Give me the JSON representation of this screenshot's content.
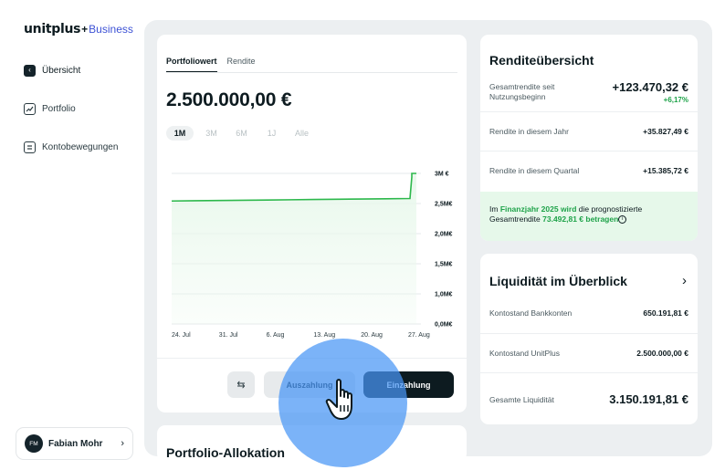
{
  "brand": {
    "name": "unitplus",
    "mark": "+",
    "suffix": "Business"
  },
  "sidebar": {
    "items": [
      {
        "label": "Übersicht",
        "icon": "overview-icon",
        "active": true
      },
      {
        "label": "Portfolio",
        "icon": "chart-trend-icon",
        "active": false
      },
      {
        "label": "Kontobewegungen",
        "icon": "transactions-icon",
        "active": false
      }
    ],
    "user": {
      "initials": "FM",
      "name": "Fabian Mohr"
    }
  },
  "portfolio": {
    "tabs": [
      "Portfoliowert",
      "Rendite"
    ],
    "active_tab": "Portfoliowert",
    "value": "2.500.000,00 €",
    "ranges": [
      "1M",
      "3M",
      "6M",
      "1J",
      "Alle"
    ],
    "active_range": "1M",
    "swap_icon": "swap-arrows-icon",
    "withdraw_label": "Auszahlung",
    "deposit_label": "Einzahlung"
  },
  "allocation": {
    "title": "Portfolio-Allokation"
  },
  "chart_data": {
    "type": "area",
    "x_ticks": [
      "24. Jul",
      "31. Jul",
      "6. Aug",
      "13. Aug",
      "20. Aug",
      "27. Aug"
    ],
    "y_ticks": [
      "3M €",
      "2,5M€",
      "2,0M€",
      "1,5M€",
      "1,0M€",
      "0,0M€"
    ],
    "ylim": [
      0,
      3000000
    ],
    "series": [
      {
        "values_by_index": [
          2450000,
          2455000,
          2460000,
          2465000,
          2470000,
          2475000,
          2480000,
          2485000,
          2490000,
          2495000,
          2500000,
          3000000
        ]
      }
    ],
    "grid": true,
    "line_color": "#2db84c",
    "fill_color": "#e9f8ec"
  },
  "rendite": {
    "title": "Renditeübersicht",
    "rows": [
      {
        "label": "Gesamtrendite seit Nutzungsbeginn",
        "value": "+123.470,32 €",
        "pct": "+6,17%"
      },
      {
        "label": "Rendite in diesem Jahr",
        "value": "+35.827,49 €"
      },
      {
        "label": "Rendite in diesem Quartal",
        "value": "+15.385,72 €"
      }
    ],
    "note": {
      "pre": "Im ",
      "hl1": "Finanzjahr 2025 wird",
      "mid": " die prognostizierte Gesamtrendite ",
      "hl2": "73.492,81 € betragen",
      "icon": "info-icon"
    }
  },
  "liquidity": {
    "title": "Liquidität im Überblick",
    "chevron_icon": "chevron-right-icon",
    "rows": [
      {
        "label": "Kontostand Bankkonten",
        "value": "650.191,81 €"
      },
      {
        "label": "Kontostand UnitPlus",
        "value": "2.500.000,00 €"
      },
      {
        "label": "Gesamte Liquidität",
        "value": "3.150.191,81 €"
      }
    ]
  },
  "colors": {
    "accent_green": "#1fa34a",
    "dark": "#0d1b20",
    "brand_blue": "#3d52d5",
    "click_highlight": "#4896f5"
  }
}
